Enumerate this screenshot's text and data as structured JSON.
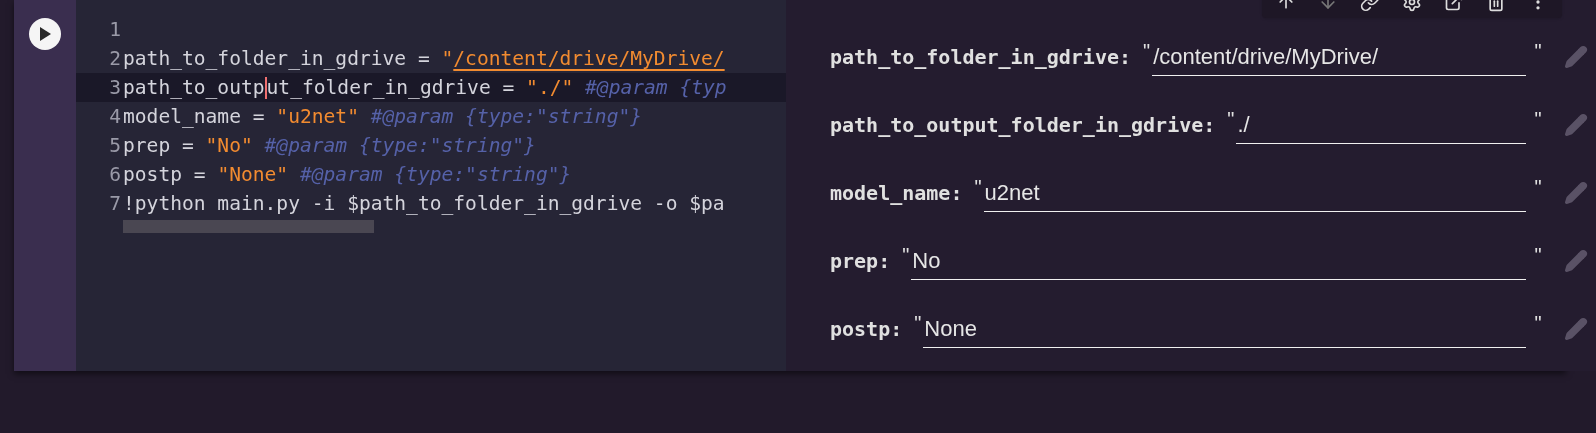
{
  "code": {
    "lines": [
      {
        "number": "1",
        "active": false
      },
      {
        "number": "2",
        "active": false,
        "tokens": [
          {
            "kind": "plain",
            "text": "path_to_folder_in_gdrive = "
          },
          {
            "kind": "string",
            "text": "\""
          },
          {
            "kind": "link",
            "text": "/content/drive/MyDrive/"
          }
        ]
      },
      {
        "number": "3",
        "active": true,
        "tokens": [
          {
            "kind": "plain",
            "text": "path_to_outp"
          },
          {
            "kind": "cursor"
          },
          {
            "kind": "plain",
            "text": "ut_folder_in_gdrive = "
          },
          {
            "kind": "string",
            "text": "\"./\""
          },
          {
            "kind": "comment",
            "text": " #@param {typ"
          }
        ]
      },
      {
        "number": "4",
        "active": false,
        "tokens": [
          {
            "kind": "plain",
            "text": "model_name = "
          },
          {
            "kind": "string",
            "text": "\"u2net\""
          },
          {
            "kind": "comment",
            "text": " #@param {type:\"string\"}"
          }
        ]
      },
      {
        "number": "5",
        "active": false,
        "tokens": [
          {
            "kind": "plain",
            "text": "prep = "
          },
          {
            "kind": "string",
            "text": "\"No\""
          },
          {
            "kind": "comment",
            "text": " #@param {type:\"string\"}"
          }
        ]
      },
      {
        "number": "6",
        "active": false,
        "tokens": [
          {
            "kind": "plain",
            "text": "postp = "
          },
          {
            "kind": "string",
            "text": "\"None\""
          },
          {
            "kind": "comment",
            "text": " #@param {type:\"string\"}"
          }
        ]
      },
      {
        "number": "7",
        "active": false,
        "tokens": [
          {
            "kind": "plain",
            "text": "!python main.py -i $path_to_folder_in_gdrive -o $pa"
          }
        ]
      }
    ]
  },
  "form": {
    "fields": [
      {
        "label": "path_to_folder_in_gdrive:",
        "open_quote": "\"",
        "value": "/content/drive/MyDrive/",
        "close_quote": "\""
      },
      {
        "label": "path_to_output_folder_in_gdrive:",
        "open_quote": "\"",
        "value": "./",
        "close_quote": "\""
      },
      {
        "label": "model_name:",
        "open_quote": "\"",
        "value": "u2net",
        "close_quote": "\""
      },
      {
        "label": "prep:",
        "open_quote": "\"",
        "value": "No",
        "close_quote": "\""
      },
      {
        "label": "postp:",
        "open_quote": "\"",
        "value": "None",
        "close_quote": "\""
      }
    ]
  }
}
